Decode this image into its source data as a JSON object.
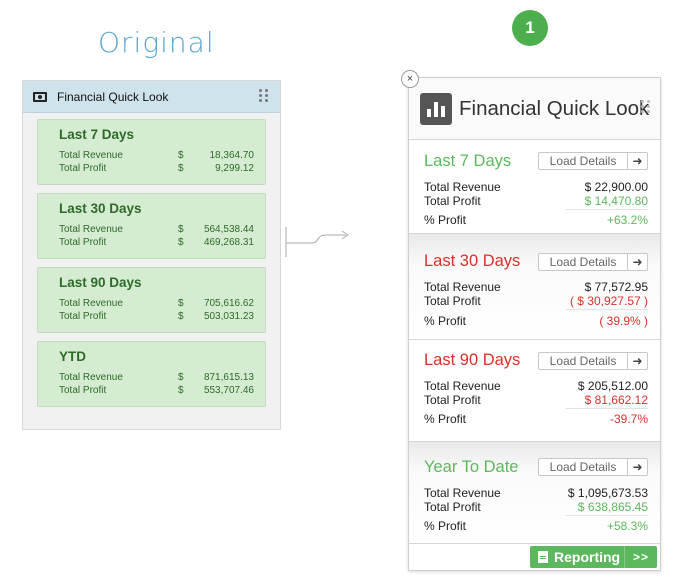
{
  "original": {
    "label": "Original",
    "widget_title": "Financial Quick Look",
    "cards": [
      {
        "title": "Last 7 Days",
        "rows": [
          {
            "label": "Total Revenue",
            "cur": "$",
            "value": "18,364.70"
          },
          {
            "label": "Total Profit",
            "cur": "$",
            "value": "9,299.12"
          }
        ]
      },
      {
        "title": "Last 30 Days",
        "rows": [
          {
            "label": "Total Revenue",
            "cur": "$",
            "value": "564,538.44"
          },
          {
            "label": "Total Profit",
            "cur": "$",
            "value": "469,268.31"
          }
        ]
      },
      {
        "title": "Last 90 Days",
        "rows": [
          {
            "label": "Total Revenue",
            "cur": "$",
            "value": "705,616.62"
          },
          {
            "label": "Total Profit",
            "cur": "$",
            "value": "503,031.23"
          }
        ]
      },
      {
        "title": "YTD",
        "rows": [
          {
            "label": "Total Revenue",
            "cur": "$",
            "value": "871,615.13"
          },
          {
            "label": "Total Profit",
            "cur": "$",
            "value": "553,707.46"
          }
        ]
      }
    ]
  },
  "step": "1",
  "close": "×",
  "new_widget": {
    "title": "Financial Quick Look",
    "load_label": "Load Details",
    "load_arrow": "➜",
    "sections": [
      {
        "title": "Last 7 Days",
        "tone": "green",
        "revenue_label": "Total Revenue",
        "revenue": "$ 22,900.00",
        "profit_label": "Total Profit",
        "profit": "$ 14,470.80",
        "pct_label": "% Profit",
        "pct": "+63.2%"
      },
      {
        "title": "Last 30 Days",
        "tone": "red",
        "revenue_label": "Total Revenue",
        "revenue": "$ 77,572.95",
        "profit_label": "Total Profit",
        "profit": "( $ 30,927.57 )",
        "pct_label": "% Profit",
        "pct": "( 39.9% )"
      },
      {
        "title": "Last 90 Days",
        "tone": "red",
        "revenue_label": "Total Revenue",
        "revenue": "$ 205,512.00",
        "profit_label": "Total Profit",
        "profit": "$ 81,662.12",
        "pct_label": "% Profit",
        "pct": "-39.7%"
      },
      {
        "title": "Year To Date",
        "tone": "green",
        "revenue_label": "Total Revenue",
        "revenue": "$ 1,095,673.53",
        "profit_label": "Total Profit",
        "profit": "$ 638,865.45",
        "pct_label": "% Profit",
        "pct": "+58.3%"
      }
    ],
    "reporting_label": "Reporting",
    "reporting_go": ">>"
  },
  "colors": {
    "green": "#5cb85c",
    "red": "#d9302b",
    "badge": "#4cae4c",
    "original_title": "#5aa6cf",
    "original_card": "#d6ecd2",
    "original_header": "#cfe3ec"
  }
}
